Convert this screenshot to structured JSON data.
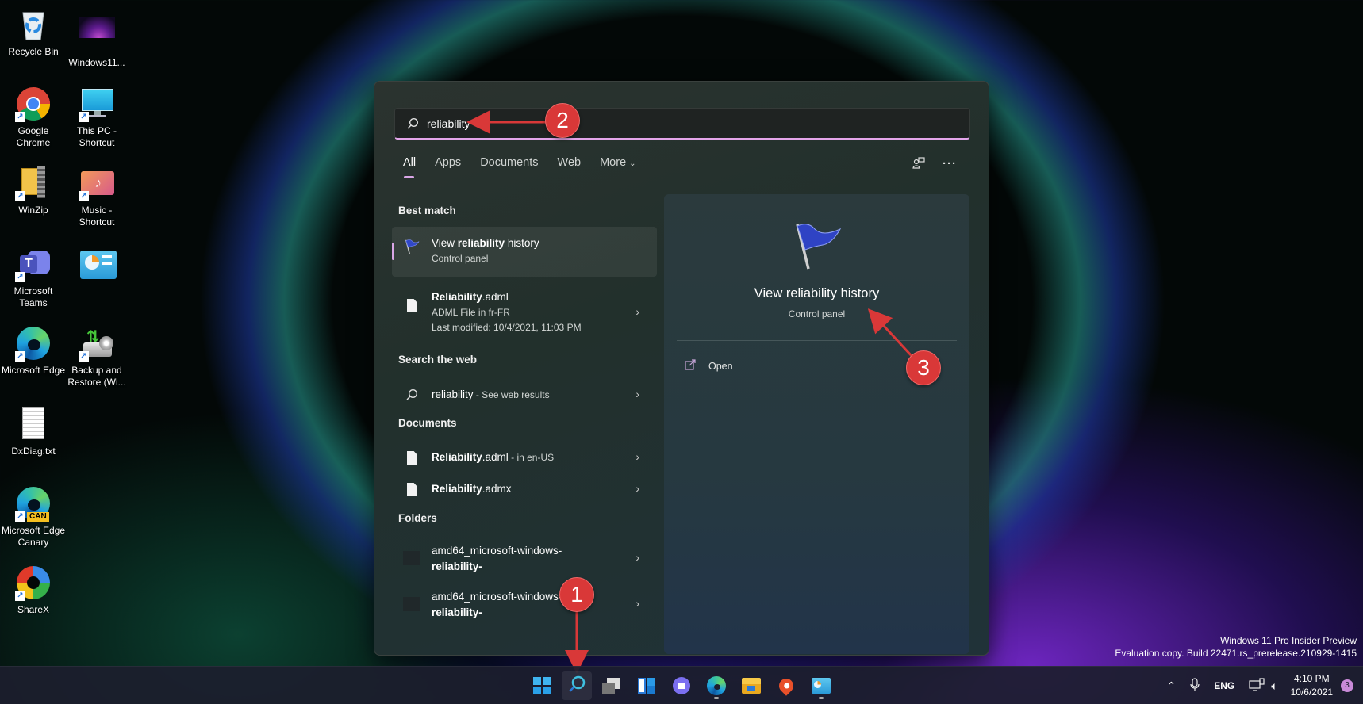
{
  "desktop": {
    "icons": [
      {
        "label": "Recycle Bin",
        "icon": "recycle-bin-icon"
      },
      {
        "label": "Windows11...",
        "icon": "image-thumbnail-icon"
      },
      {
        "label": "Google Chrome",
        "icon": "chrome-icon"
      },
      {
        "label": "This PC - Shortcut",
        "icon": "monitor-icon"
      },
      {
        "label": "WinZip",
        "icon": "winzip-icon"
      },
      {
        "label": "Music - Shortcut",
        "icon": "music-folder-icon"
      },
      {
        "label": "Microsoft Teams",
        "icon": "teams-icon"
      },
      {
        "label": "",
        "icon": "control-panel-icon"
      },
      {
        "label": "Microsoft Edge",
        "icon": "edge-icon"
      },
      {
        "label": "Backup and Restore (Wi...",
        "icon": "backup-icon"
      },
      {
        "label": "DxDiag.txt",
        "icon": "text-file-icon"
      },
      {
        "label": "Microsoft Edge Canary",
        "icon": "edge-canary-icon",
        "badge": "CAN"
      },
      {
        "label": "ShareX",
        "icon": "sharex-icon"
      }
    ]
  },
  "search": {
    "query": "reliability",
    "tabs": [
      "All",
      "Apps",
      "Documents",
      "Web",
      "More"
    ],
    "active_tab": "All",
    "header_icons": [
      "account-switch-icon",
      "more-options-icon"
    ],
    "sections": {
      "best_match": "Best match",
      "search_web": "Search the web",
      "documents": "Documents",
      "folders": "Folders"
    },
    "best_match": {
      "title_pre": "View ",
      "title_bold": "reliability",
      "title_post": " history",
      "subtitle": "Control panel"
    },
    "apps_result": {
      "title_bold": "Reliability",
      "title_post": ".adml",
      "line1": "ADML File in fr-FR",
      "line2": "Last modified: 10/4/2021, 11:03 PM"
    },
    "web_result": {
      "term": "reliability",
      "suffix": " - See web results"
    },
    "documents": [
      {
        "bold": "Reliability",
        "rest": ".adml",
        "suffix": " - in en-US"
      },
      {
        "bold": "Reliability",
        "rest": ".admx",
        "suffix": ""
      }
    ],
    "folders": [
      {
        "line1": "amd64_microsoft-windows-",
        "line2": "reliability-"
      },
      {
        "line1": "amd64_microsoft-windows-",
        "line2": "reliability-"
      }
    ],
    "preview": {
      "title": "View reliability history",
      "subtitle": "Control panel",
      "open_label": "Open"
    }
  },
  "annotations": [
    {
      "number": "1",
      "target": "taskbar search button"
    },
    {
      "number": "2",
      "target": "search input"
    },
    {
      "number": "3",
      "target": "preview title"
    }
  ],
  "colors": {
    "accent": "#d9a6e6",
    "marker": "#d93838"
  },
  "taskbar": {
    "apps": [
      "start-icon",
      "search-icon",
      "task-view-icon",
      "widgets-icon",
      "teams-chat-icon",
      "edge-icon",
      "file-explorer-icon",
      "maps-icon",
      "control-panel-icon"
    ],
    "tray": {
      "language": "ENG",
      "time": "4:10 PM",
      "date": "10/6/2021",
      "notification_count": "3"
    }
  },
  "watermark": {
    "line1": "Windows 11 Pro Insider Preview",
    "line2": "Evaluation copy. Build 22471.rs_prerelease.210929-1415"
  }
}
